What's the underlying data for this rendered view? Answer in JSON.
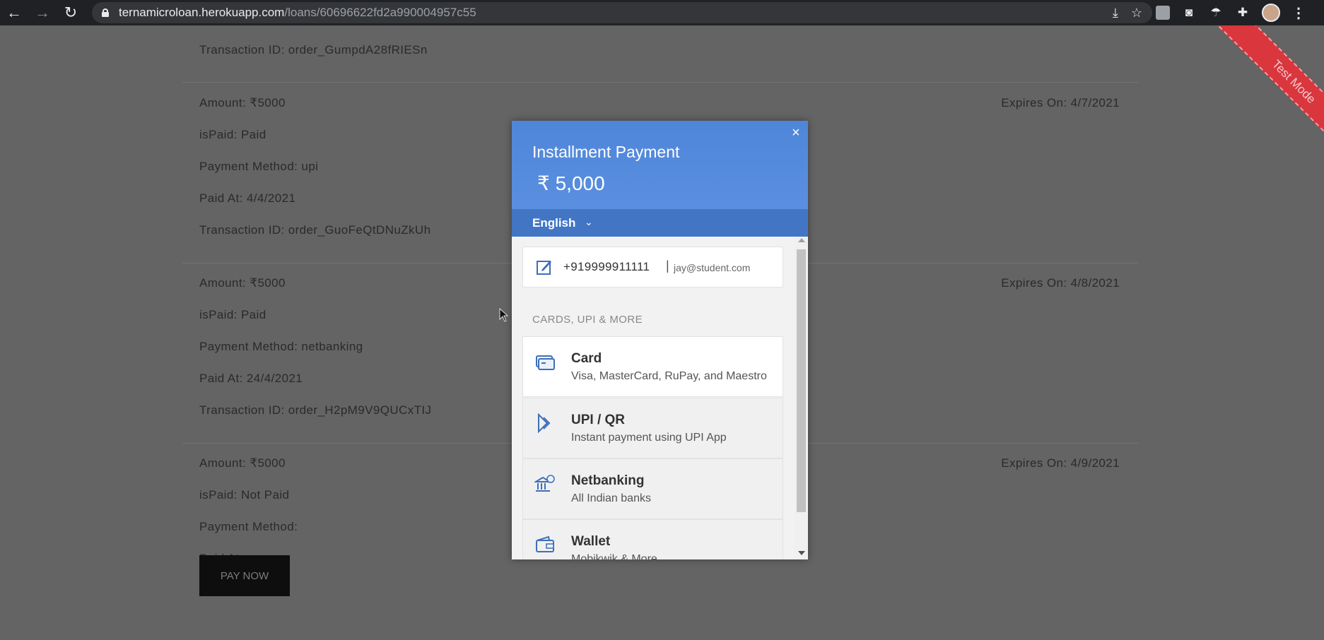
{
  "browser": {
    "back_icon": "←",
    "forward_icon": "→",
    "reload_icon": "↻",
    "url_host": "ternamicroloan.herokuapp.com",
    "url_path": "/loans/60696622fd2a990004957c55",
    "install_icon": "⤓",
    "star_icon": "☆",
    "camera_icon": "◙",
    "ext_icon": "☂",
    "puzzle_icon": "✚",
    "menu_icon": "⋮"
  },
  "page": {
    "installments": [
      {
        "transaction": "Transaction ID: order_GumpdA28fRIESn"
      },
      {
        "amount": "Amount: ₹5000",
        "expires": "Expires On: 4/7/2021",
        "is_paid": "isPaid: Paid",
        "method": "Payment Method: upi",
        "paid_at": "Paid At: 4/4/2021",
        "transaction": "Transaction ID: order_GuoFeQtDNuZkUh"
      },
      {
        "amount": "Amount: ₹5000",
        "expires": "Expires On: 4/8/2021",
        "is_paid": "isPaid: Paid",
        "method": "Payment Method: netbanking",
        "paid_at": "Paid At: 24/4/2021",
        "transaction": "Transaction ID: order_H2pM9V9QUCxTIJ"
      },
      {
        "amount": "Amount: ₹5000",
        "expires": "Expires On: 4/9/2021",
        "is_paid": "isPaid: Not Paid",
        "method": "Payment Method:",
        "paid_at": "Paid At:"
      }
    ],
    "pay_now": "PAY NOW",
    "ribbon": "Test Mode"
  },
  "checkout": {
    "title": "Installment Payment",
    "amount": "₹ 5,000",
    "close": "×",
    "language": "English",
    "language_chevron": "⌄",
    "phone": "+919999911111",
    "separator": "|",
    "email": "jay@student.com",
    "section_label": "CARDS, UPI & MORE",
    "methods": [
      {
        "title": "Card",
        "subtitle": "Visa, MasterCard, RuPay, and Maestro",
        "icon": "card-icon"
      },
      {
        "title": "UPI / QR",
        "subtitle": "Instant payment using UPI App",
        "icon": "upi-icon"
      },
      {
        "title": "Netbanking",
        "subtitle": "All Indian banks",
        "icon": "bank-icon"
      },
      {
        "title": "Wallet",
        "subtitle": "Mobikwik & More",
        "icon": "wallet-icon"
      }
    ],
    "accent": "#528ff0"
  }
}
